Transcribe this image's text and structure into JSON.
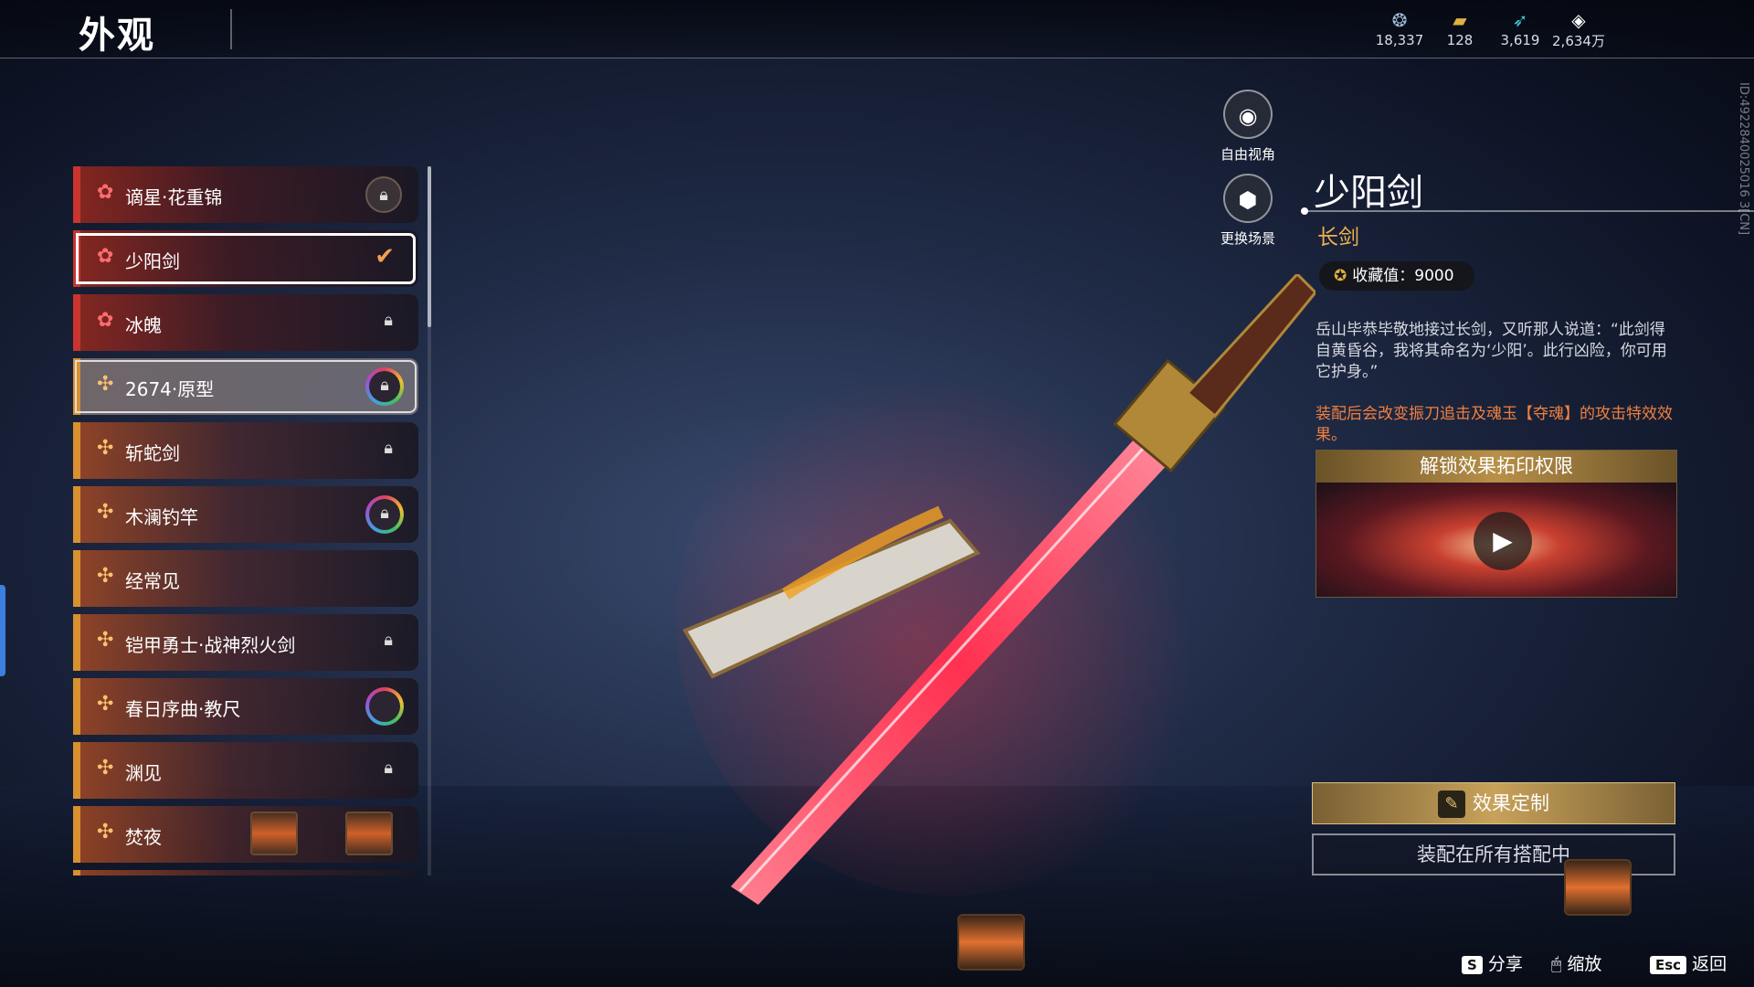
{
  "header": {
    "title": "外观",
    "currencies": [
      {
        "icon": "coin-icon",
        "value": "18,337"
      },
      {
        "icon": "gold-bar-icon",
        "value": "128"
      },
      {
        "icon": "feather-icon",
        "value": "3,619"
      },
      {
        "icon": "diamond-icon",
        "value": "2,634万"
      }
    ]
  },
  "sidebar": {
    "items": [
      {
        "label": "谪星·花重锦",
        "rarity": "red",
        "status": "lock-circle"
      },
      {
        "label": "少阳剑",
        "rarity": "red",
        "status": "equipped"
      },
      {
        "label": "冰魄",
        "rarity": "red",
        "status": "lock"
      },
      {
        "label": "2674·原型",
        "rarity": "orange",
        "status": "ring-lock"
      },
      {
        "label": "斩蛇剑",
        "rarity": "orange",
        "status": "lock"
      },
      {
        "label": "木澜钓竿",
        "rarity": "orange",
        "status": "ring-lock"
      },
      {
        "label": "经常见",
        "rarity": "orange",
        "status": "none"
      },
      {
        "label": "铠甲勇士·战神烈火剑",
        "rarity": "orange",
        "status": "lock"
      },
      {
        "label": "春日序曲·教尺",
        "rarity": "orange",
        "status": "ring"
      },
      {
        "label": "渊见",
        "rarity": "orange",
        "status": "lock"
      },
      {
        "label": "焚夜",
        "rarity": "orange",
        "status": "lanterns"
      }
    ]
  },
  "camera": {
    "free_view": "自由视角",
    "change_scene": "更换场景"
  },
  "detail": {
    "name": "少阳剑",
    "type": "长剑",
    "collection_label": "收藏值：9000",
    "description": "岳山毕恭毕敬地接过长剑，又听那人说道：“此剑得自黄昏谷，我将其命名为‘少阳’。此行凶险，你可用它护身。”",
    "effect_note": "装配后会改变振刀追击及魂玉【夺魂】的攻击特效效果。",
    "unlock_title": "解锁效果拓印权限",
    "customize_button": "效果定制",
    "equip_all_button": "装配在所有搭配中"
  },
  "vertical_id": "ID:4922840025016 3[CN]",
  "footer": {
    "share_key": "S",
    "share_label": "分享",
    "zoom_label": "缩放",
    "back_key": "Esc",
    "back_label": "返回"
  },
  "colors": {
    "red_rarity": "#c8352e",
    "orange_rarity": "#d89030",
    "accent_gold": "#f0b050",
    "effect_orange": "#f08040"
  }
}
